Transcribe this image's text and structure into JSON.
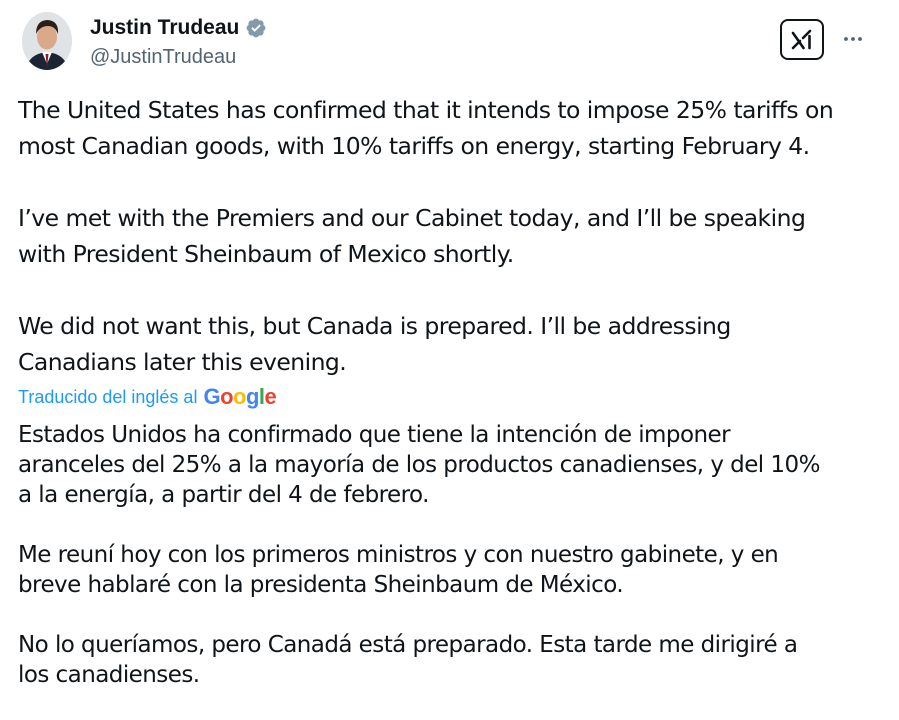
{
  "author": {
    "display_name": "Justin Trudeau",
    "handle": "@JustinTrudeau",
    "verified": true,
    "verified_color": "#829aab"
  },
  "actions": {
    "grok_icon": "grok-logo",
    "more_icon": "more-horizontal"
  },
  "tweet": {
    "paragraphs": [
      "The United States has confirmed that it intends to impose 25% tariffs on\nmost Canadian goods, with 10% tariffs on energy, starting February 4.",
      "I’ve met with the Premiers and our Cabinet today, and I’ll be speaking\nwith President Sheinbaum of Mexico shortly.",
      "We did not want this, but Canada is prepared. I’ll be addressing\nCanadians later this evening."
    ]
  },
  "translation": {
    "label": "Traducido del inglés al",
    "provider": "Google",
    "link_color": "#1d9bf0",
    "paragraphs": [
      "Estados Unidos ha confirmado que tiene la intención de imponer\naranceles del 25% a la mayoría de los productos canadienses, y del 10%\na la energía, a partir del 4 de febrero.",
      "Me reuní hoy con los primeros ministros y con nuestro gabinete, y en\nbreve hablaré con la presidenta Sheinbaum de México.",
      "No lo queríamos, pero Canadá está preparado. Esta tarde me dirigiré a\nlos canadienses."
    ]
  }
}
